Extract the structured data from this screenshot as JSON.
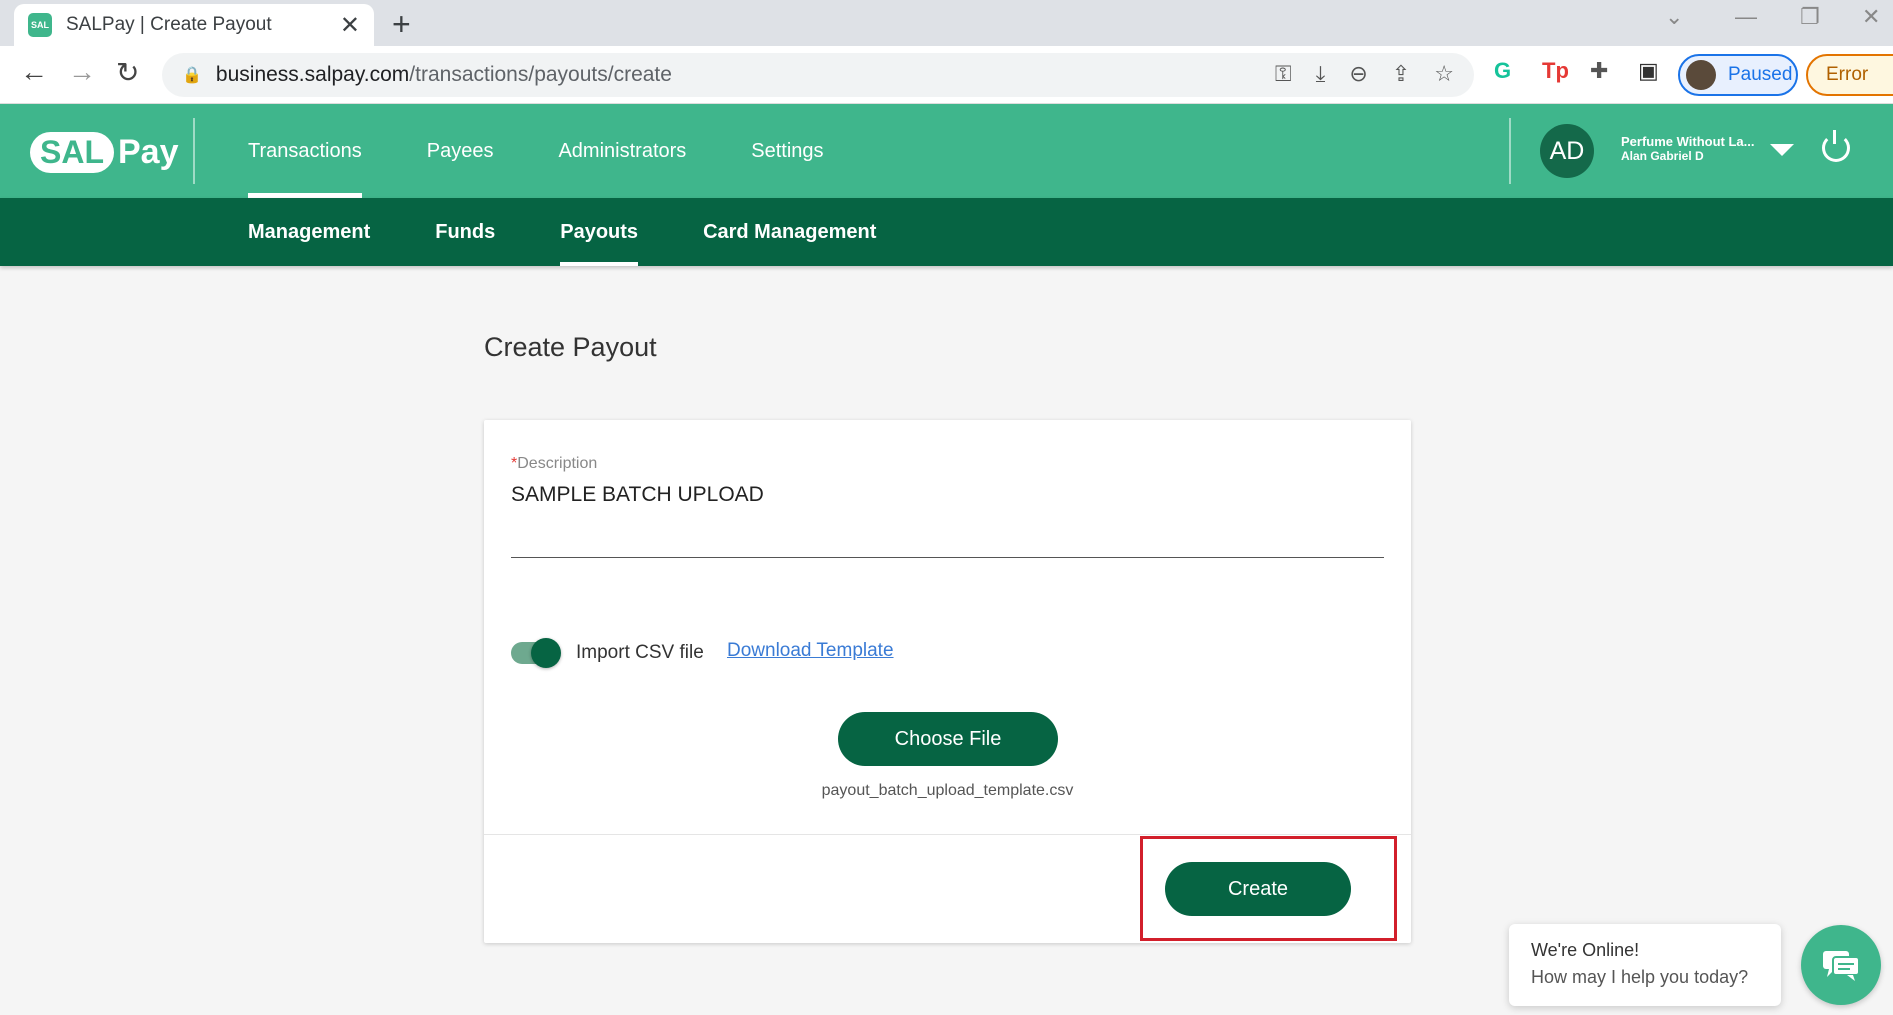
{
  "browser": {
    "tab_title": "SALPay | Create Payout",
    "favicon_text": "SAL",
    "url_domain": "business.salpay.com",
    "url_path": "/transactions/payouts/create",
    "profile_label": "Paused",
    "error_label": "Error"
  },
  "header": {
    "logo_sal": "SAL",
    "logo_pay": "Pay",
    "nav": [
      {
        "label": "Transactions",
        "active": true
      },
      {
        "label": "Payees",
        "active": false
      },
      {
        "label": "Administrators",
        "active": false
      },
      {
        "label": "Settings",
        "active": false
      }
    ],
    "avatar_initials": "AD",
    "merchant_name": "Perfume Without La...",
    "user_name": "Alan Gabriel D"
  },
  "subnav": [
    {
      "label": "Management",
      "active": false
    },
    {
      "label": "Funds",
      "active": false
    },
    {
      "label": "Payouts",
      "active": true
    },
    {
      "label": "Card Management",
      "active": false
    }
  ],
  "page": {
    "title": "Create Payout",
    "description_label": "Description",
    "description_required_mark": "*",
    "description_value": "SAMPLE BATCH UPLOAD",
    "import_csv_label": "Import CSV file",
    "import_csv_enabled": true,
    "download_template_label": "Download Template",
    "choose_file_label": "Choose File",
    "file_name": "payout_batch_upload_template.csv",
    "create_label": "Create"
  },
  "chat": {
    "line1": "We're Online!",
    "line2": "How may I help you today?"
  },
  "colors": {
    "brand_green": "#3fb68c",
    "dark_green": "#066443",
    "highlight_red": "#d21f2b"
  }
}
